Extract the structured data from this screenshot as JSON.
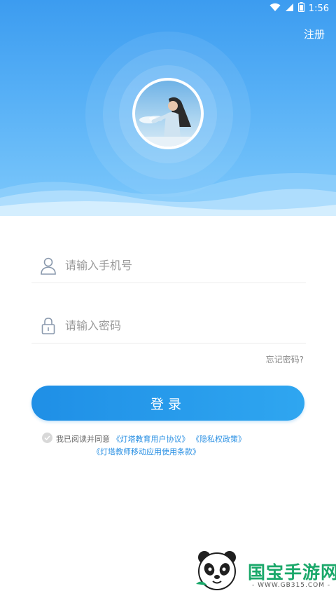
{
  "status_bar": {
    "time": "1:56"
  },
  "header": {
    "register_label": "注册"
  },
  "form": {
    "phone_placeholder": "请输入手机号",
    "password_placeholder": "请输入密码",
    "forgot_label": "忘记密码?",
    "login_label": "登录"
  },
  "agreement": {
    "prefix": "我已阅读并同意",
    "user_agreement": "《灯塔教育用户协议》",
    "privacy_policy": "《隐私权政策》",
    "terms": "《灯塔教师移动应用使用条款》"
  },
  "watermark": {
    "title": "国宝手游网",
    "url": "- WWW.GB315.COM -"
  },
  "colors": {
    "primary": "#2a90e3",
    "header_top": "#3c9cf0",
    "watermark_green": "#1aa86a"
  }
}
